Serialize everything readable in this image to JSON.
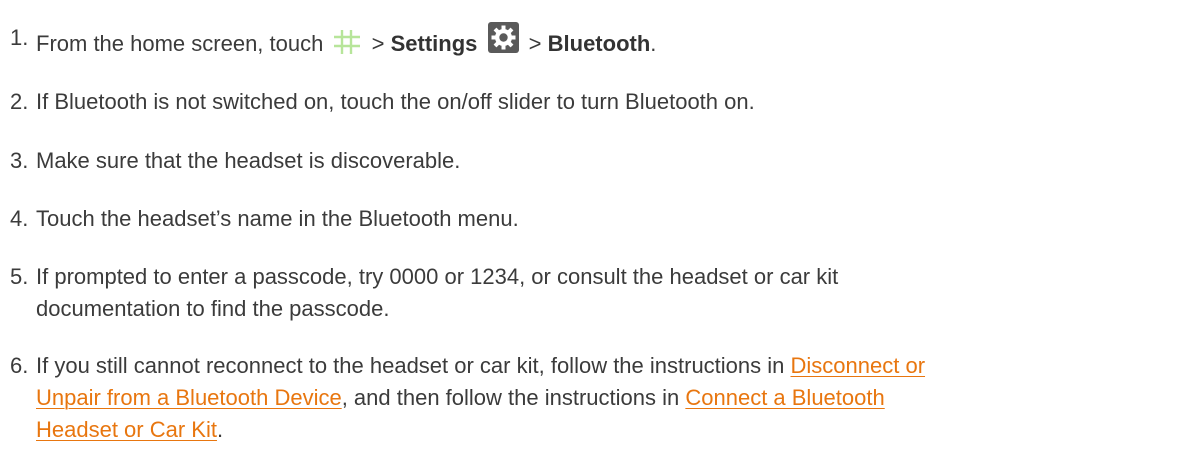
{
  "colors": {
    "text": "#3b3b3b",
    "link": "#e8760f",
    "apps_icon": "#b7e59a",
    "settings_icon_bg": "#5a5a5a"
  },
  "steps": [
    {
      "num": "1.",
      "pre": "From the home screen, touch",
      "icon1": "apps-grid-icon",
      "mid": ">",
      "settings": "Settings",
      "icon2": "gear-icon",
      "gt2": ">",
      "bluetooth": "Bluetooth",
      "end": "."
    },
    {
      "num": "2.",
      "text": "If Bluetooth is not switched on, touch the on/off slider to turn Bluetooth on."
    },
    {
      "num": "3.",
      "text": "Make sure that the headset is discoverable."
    },
    {
      "num": "4.",
      "text": "Touch the headset’s name in the Bluetooth menu."
    },
    {
      "num": "5.",
      "line1": "If prompted to enter a passcode, try 0000 or 1234, or consult the headset or car kit",
      "line2": "documentation to find the passcode."
    },
    {
      "num": "6.",
      "pre": "If you still cannot reconnect to the headset or car kit, follow the instructions in",
      "link1_part1": "Disconnect or",
      "link1_part2": "Unpair from a Bluetooth Device",
      "mid": ", and then follow the instructions in",
      "link2_part1": "Connect a Bluetooth",
      "link2_part2": "Headset or Car Kit",
      "end": "."
    }
  ]
}
